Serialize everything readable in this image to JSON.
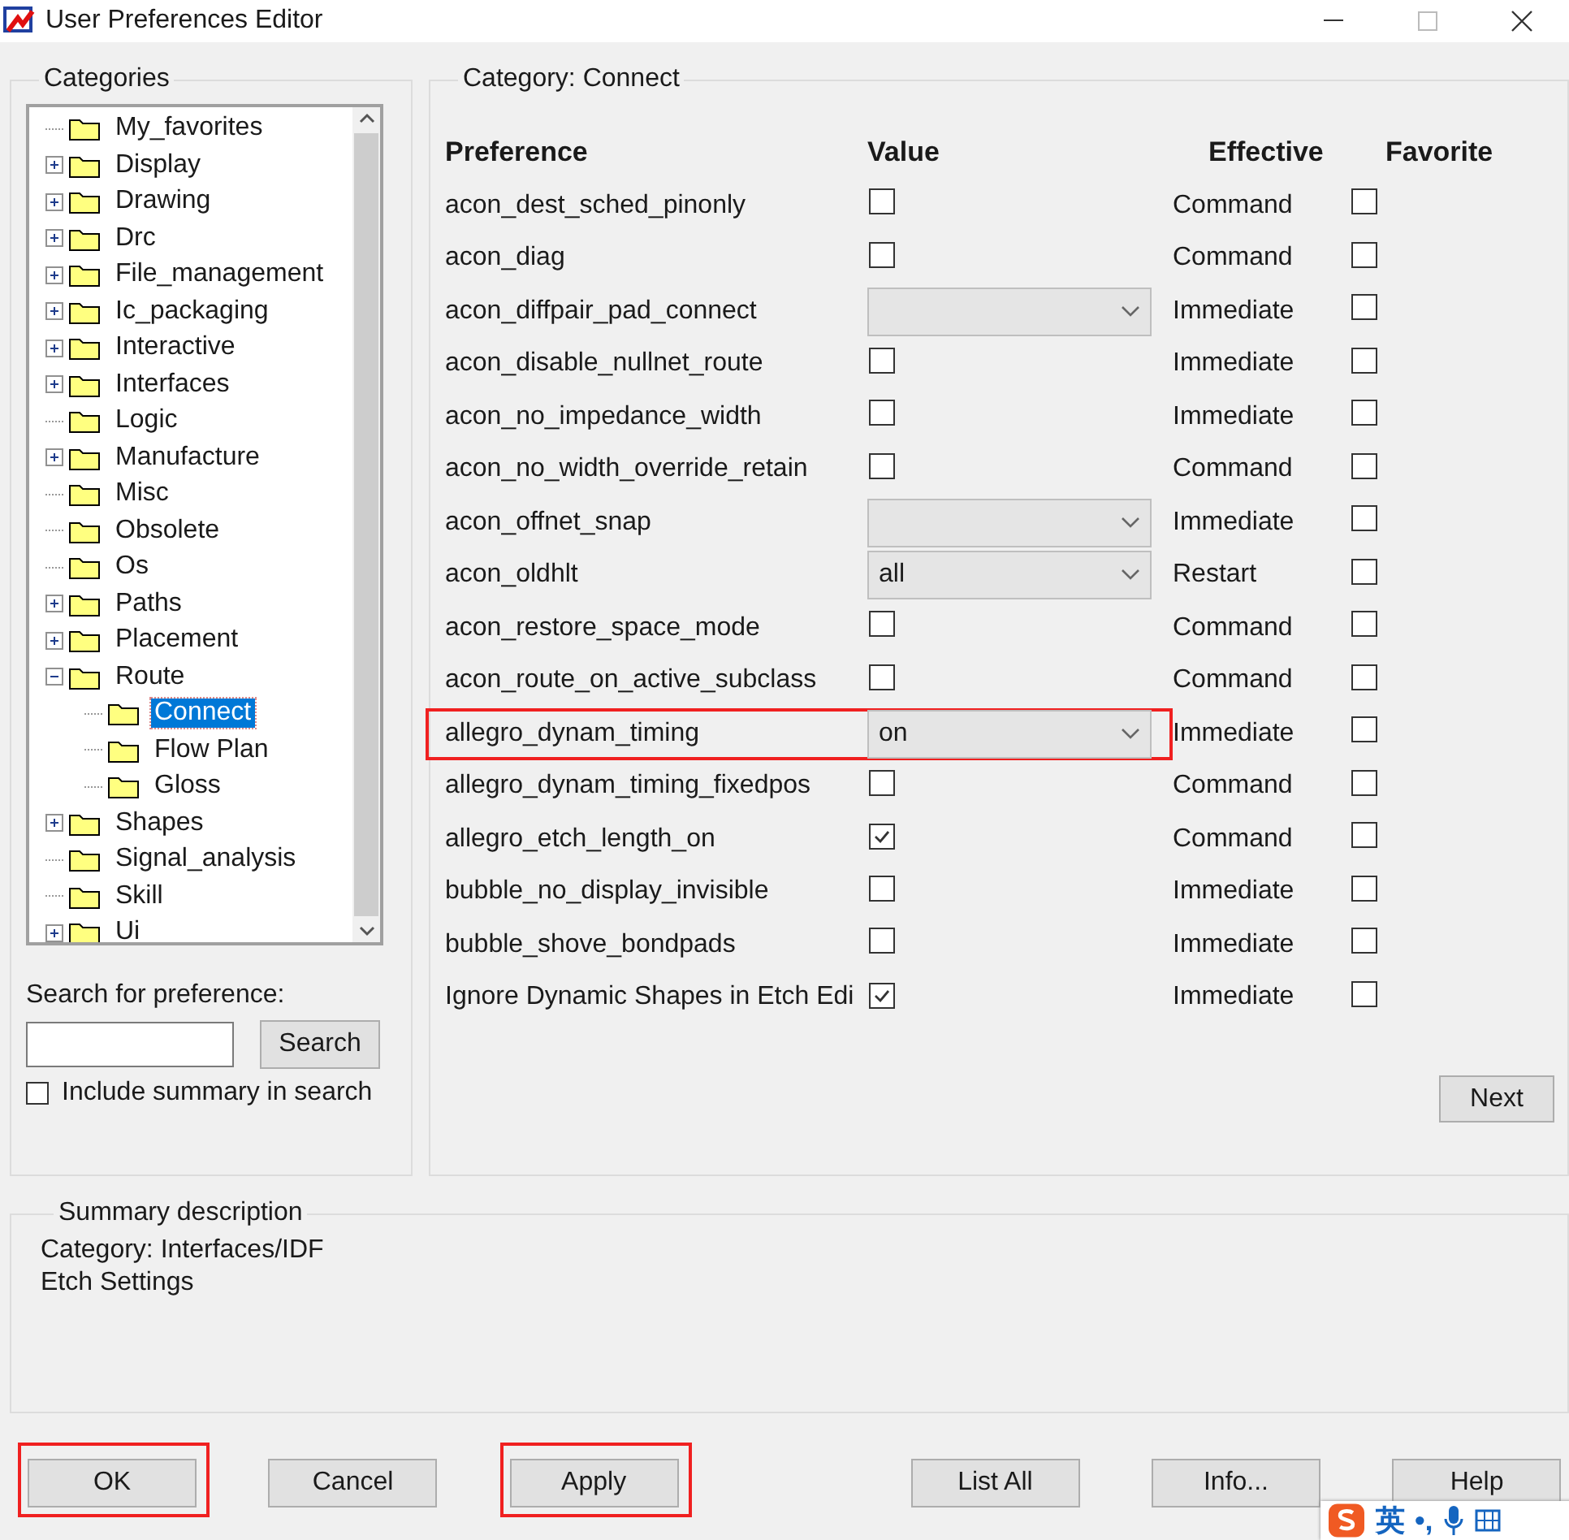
{
  "window": {
    "title": "User Preferences Editor"
  },
  "categories": {
    "title": "Categories",
    "tree": [
      {
        "label": "My_favorites",
        "selected": false
      },
      {
        "label": "Display",
        "expanded": false,
        "selected": false
      },
      {
        "label": "Drawing",
        "expanded": false,
        "selected": false
      },
      {
        "label": "Drc",
        "expanded": false,
        "selected": false
      },
      {
        "label": "File_management",
        "expanded": false,
        "selected": false
      },
      {
        "label": "Ic_packaging",
        "expanded": false,
        "selected": false
      },
      {
        "label": "Interactive",
        "expanded": false,
        "selected": false
      },
      {
        "label": "Interfaces",
        "expanded": false,
        "selected": false
      },
      {
        "label": "Logic",
        "selected": false
      },
      {
        "label": "Manufacture",
        "expanded": false,
        "selected": false
      },
      {
        "label": "Misc",
        "selected": false
      },
      {
        "label": "Obsolete",
        "selected": false
      },
      {
        "label": "Os",
        "selected": false
      },
      {
        "label": "Paths",
        "expanded": false,
        "selected": false
      },
      {
        "label": "Placement",
        "expanded": false,
        "selected": false
      },
      {
        "label": "Route",
        "expanded": true,
        "selected": false,
        "children": [
          {
            "label": "Connect",
            "selected": true
          },
          {
            "label": "Flow Plan",
            "selected": false
          },
          {
            "label": "Gloss",
            "selected": false
          }
        ]
      },
      {
        "label": "Shapes",
        "expanded": false,
        "selected": false
      },
      {
        "label": "Signal_analysis",
        "selected": false
      },
      {
        "label": "Skill",
        "selected": false
      },
      {
        "label": "Ui",
        "expanded": false,
        "selected": false
      }
    ],
    "search_label": "Search for preference:",
    "search_button": "Search",
    "include_summary": {
      "label": "Include summary in search",
      "checked": false
    }
  },
  "preferences": {
    "title": "Category:  Connect",
    "columns": [
      "Preference",
      "Value",
      "Effective",
      "Favorite"
    ],
    "rows": [
      {
        "name": "acon_dest_sched_pinonly",
        "kind": "checkbox",
        "checked": false,
        "effective": "Command",
        "favorite": false,
        "annotated": false
      },
      {
        "name": "acon_diag",
        "kind": "checkbox",
        "checked": false,
        "effective": "Command",
        "favorite": false,
        "annotated": false
      },
      {
        "name": "acon_diffpair_pad_connect",
        "kind": "dropdown",
        "value": "",
        "effective": "Immediate",
        "favorite": false,
        "annotated": false
      },
      {
        "name": "acon_disable_nullnet_route",
        "kind": "checkbox",
        "checked": false,
        "effective": "Immediate",
        "favorite": false,
        "annotated": false
      },
      {
        "name": "acon_no_impedance_width",
        "kind": "checkbox",
        "checked": false,
        "effective": "Immediate",
        "favorite": false,
        "annotated": false
      },
      {
        "name": "acon_no_width_override_retain",
        "kind": "checkbox",
        "checked": false,
        "effective": "Command",
        "favorite": false,
        "annotated": false
      },
      {
        "name": "acon_offnet_snap",
        "kind": "dropdown",
        "value": "",
        "effective": "Immediate",
        "favorite": false,
        "annotated": false
      },
      {
        "name": "acon_oldhlt",
        "kind": "dropdown",
        "value": "all",
        "effective": "Restart",
        "favorite": false,
        "annotated": false
      },
      {
        "name": "acon_restore_space_mode",
        "kind": "checkbox",
        "checked": false,
        "effective": "Command",
        "favorite": false,
        "annotated": false
      },
      {
        "name": "acon_route_on_active_subclass",
        "kind": "checkbox",
        "checked": false,
        "effective": "Command",
        "favorite": false,
        "annotated": false
      },
      {
        "name": "allegro_dynam_timing",
        "kind": "dropdown",
        "value": "on",
        "effective": "Immediate",
        "favorite": false,
        "annotated": true
      },
      {
        "name": "allegro_dynam_timing_fixedpos",
        "kind": "checkbox",
        "checked": false,
        "effective": "Command",
        "favorite": false,
        "annotated": false
      },
      {
        "name": "allegro_etch_length_on",
        "kind": "checkbox",
        "checked": true,
        "effective": "Command",
        "favorite": false,
        "annotated": false
      },
      {
        "name": "bubble_no_display_invisible",
        "kind": "checkbox",
        "checked": false,
        "effective": "Immediate",
        "favorite": false,
        "annotated": false
      },
      {
        "name": "bubble_shove_bondpads",
        "kind": "checkbox",
        "checked": false,
        "effective": "Immediate",
        "favorite": false,
        "annotated": false
      },
      {
        "name": "Ignore Dynamic Shapes in Etch Edi",
        "kind": "checkbox",
        "checked": true,
        "effective": "Immediate",
        "favorite": false,
        "annotated": false
      }
    ],
    "next_button": "Next"
  },
  "summary": {
    "title": "Summary description",
    "lines": [
      "Category: Interfaces/IDF",
      "Etch Settings"
    ]
  },
  "buttons": [
    {
      "label": "OK",
      "annotated": true
    },
    {
      "label": "Cancel",
      "annotated": false
    },
    {
      "label": "Apply",
      "annotated": true
    },
    {
      "label": "List All",
      "annotated": false
    },
    {
      "label": "Info...",
      "annotated": false
    },
    {
      "label": "Help",
      "annotated": false
    }
  ],
  "ime_bar": {
    "mode": "英",
    "punctuation": "•,"
  }
}
